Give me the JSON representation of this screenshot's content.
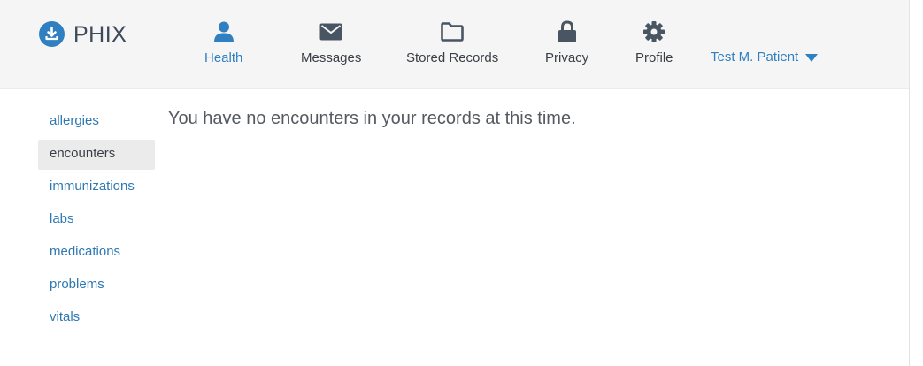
{
  "brand": {
    "name": "PHIX",
    "icon": "download-icon",
    "color": "#2f7fc1"
  },
  "nav": {
    "items": [
      {
        "label": "Health",
        "icon": "person-icon",
        "active": true
      },
      {
        "label": "Messages",
        "icon": "envelope-icon",
        "active": false
      },
      {
        "label": "Stored Records",
        "icon": "folder-icon",
        "active": false
      },
      {
        "label": "Privacy",
        "icon": "lock-icon",
        "active": false
      },
      {
        "label": "Profile",
        "icon": "gear-icon",
        "active": false
      }
    ]
  },
  "user_menu": {
    "name": "Test M. Patient",
    "icon": "caret-down-icon"
  },
  "sidebar": {
    "items": [
      {
        "label": "allergies",
        "active": false
      },
      {
        "label": "encounters",
        "active": true
      },
      {
        "label": "immunizations",
        "active": false
      },
      {
        "label": "labs",
        "active": false
      },
      {
        "label": "medications",
        "active": false
      },
      {
        "label": "problems",
        "active": false
      },
      {
        "label": "vitals",
        "active": false
      }
    ]
  },
  "main": {
    "message": "You have no encounters in your records at this time."
  },
  "colors": {
    "accent": "#2f7fc1",
    "link": "#2e78b2",
    "nav_text": "#3a3f45",
    "header_bg": "#f5f5f5",
    "active_item_bg": "#ebebeb"
  }
}
